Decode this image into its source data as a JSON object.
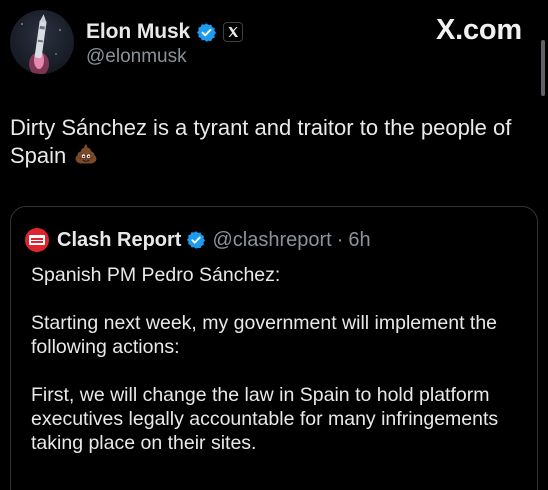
{
  "brand": "X.com",
  "author": {
    "display_name": "Elon Musk",
    "handle": "@elonmusk",
    "avatar_icon": "rocket-launch-avatar",
    "verified_icon": "verified-badge-icon",
    "affiliation_icon": "x-logo-icon"
  },
  "tweet": {
    "text": "Dirty Sánchez is a tyrant and traitor to the people of Spain",
    "emoji": "pile-of-poo-emoji"
  },
  "quote": {
    "display_name": "Clash Report",
    "handle": "@clashreport",
    "separator": "·",
    "time": "6h",
    "paragraphs": [
      "Spanish PM Pedro Sánchez:",
      "Starting next week, my government will implement the following actions:",
      "First, we will change the law in Spain to hold platform executives legally accountable for many infringements taking place on their sites."
    ]
  },
  "colors": {
    "background": "#000000",
    "text_primary": "#e7e9ea",
    "text_secondary": "#8b9299",
    "verified_blue": "#1d9bf0",
    "border": "#2f3336",
    "clash_red": "#e0242f"
  }
}
